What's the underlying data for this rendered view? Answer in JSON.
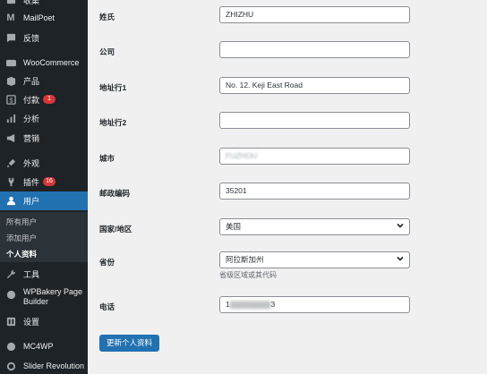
{
  "sidebar": {
    "items": [
      {
        "label": "收集",
        "icon": "collect-icon"
      },
      {
        "label": "MailPoet",
        "icon": "mailpoet-icon"
      },
      {
        "label": "反馈",
        "icon": "feedback-icon"
      },
      {
        "label": "WooCommerce",
        "icon": "woocommerce-icon"
      },
      {
        "label": "产品",
        "icon": "products-icon"
      },
      {
        "label": "付款",
        "icon": "payments-icon",
        "badge": "1"
      },
      {
        "label": "分析",
        "icon": "analytics-icon"
      },
      {
        "label": "营销",
        "icon": "marketing-icon"
      },
      {
        "label": "外观",
        "icon": "appearance-icon"
      },
      {
        "label": "插件",
        "icon": "plugins-icon",
        "badge": "16"
      },
      {
        "label": "用户",
        "icon": "users-icon"
      },
      {
        "label": "工具",
        "icon": "tools-icon"
      },
      {
        "label": "WPBakery Page Builder",
        "icon": "wpbakery-icon"
      },
      {
        "label": "设置",
        "icon": "settings-icon"
      },
      {
        "label": "MC4WP",
        "icon": "mc4wp-icon"
      },
      {
        "label": "Slider Revolution",
        "icon": "slider-revolution-icon"
      }
    ],
    "submenu": [
      "所有用户",
      "添加用户",
      "个人资料"
    ]
  },
  "form": {
    "last_name": {
      "label": "姓氏",
      "value": "ZHIZHU"
    },
    "company": {
      "label": "公司",
      "value": ""
    },
    "address1": {
      "label": "地址行1",
      "value": "No. 12. Keji East Road"
    },
    "address2": {
      "label": "地址行2",
      "value": ""
    },
    "city": {
      "label": "城市",
      "value": "FUZHOU"
    },
    "postcode": {
      "label": "邮政编码",
      "value": "35201"
    },
    "country": {
      "label": "国家/地区",
      "value": "美国"
    },
    "state": {
      "label": "省份",
      "value": "阿拉斯加州",
      "hint": "省级区域或其代码"
    },
    "phone": {
      "label": "电话",
      "value_start": "1",
      "value_end": "3"
    }
  },
  "submit_label": "更新个人资料",
  "colors": {
    "accent": "#2271b1",
    "sidebar_bg": "#1d2327",
    "badge": "#d63638"
  }
}
